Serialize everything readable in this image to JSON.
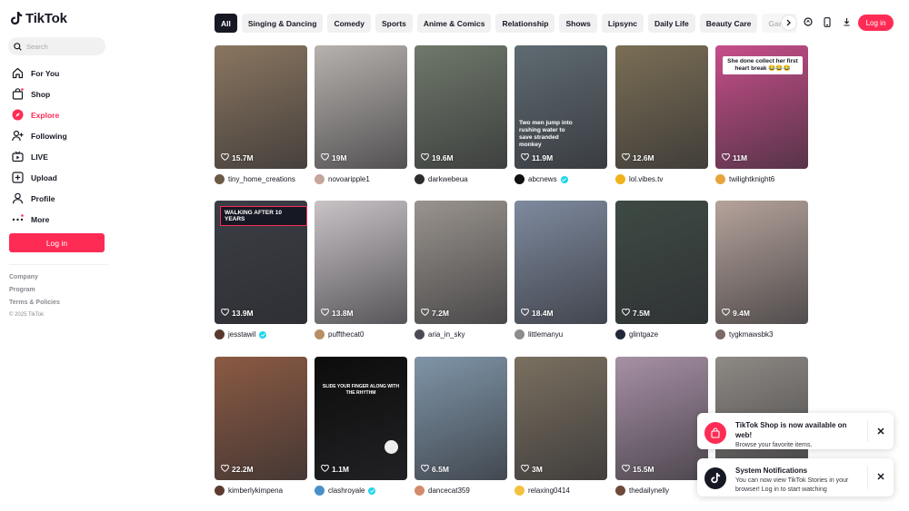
{
  "app": {
    "brand": "TikTok"
  },
  "search": {
    "placeholder": "Search"
  },
  "nav": [
    {
      "label": "For You",
      "icon": "home-icon"
    },
    {
      "label": "Shop",
      "icon": "shop-icon"
    },
    {
      "label": "Explore",
      "icon": "compass-icon",
      "active": true
    },
    {
      "label": "Following",
      "icon": "following-icon"
    },
    {
      "label": "LIVE",
      "icon": "live-icon"
    },
    {
      "label": "Upload",
      "icon": "upload-icon"
    },
    {
      "label": "Profile",
      "icon": "profile-icon"
    },
    {
      "label": "More",
      "icon": "more-icon"
    }
  ],
  "sidebar": {
    "login": "Log in",
    "footer": [
      "Company",
      "Program",
      "Terms & Policies"
    ],
    "copyright": "© 2025 TikTok"
  },
  "header": {
    "login": "Log in"
  },
  "categories": [
    "All",
    "Singing & Dancing",
    "Comedy",
    "Sports",
    "Anime & Comics",
    "Relationship",
    "Shows",
    "Lipsync",
    "Daily Life",
    "Beauty Care",
    "Games"
  ],
  "videos": [
    {
      "views": "15.7M",
      "author": "tiny_home_creations",
      "verified": false,
      "bg": "#8a7660",
      "av": "#6b5a48"
    },
    {
      "views": "19M",
      "author": "novoaripple1",
      "verified": false,
      "bg": "#b7b2ae",
      "av": "#c6a69a"
    },
    {
      "views": "19.6M",
      "author": "darkwebeua",
      "verified": false,
      "bg": "#6f786a",
      "av": "#2d2d2d"
    },
    {
      "views": "11.9M",
      "author": "abcnews",
      "verified": true,
      "bg": "#5f6b72",
      "av": "#111111",
      "overlay": "Two men jump into rushing water to save stranded monkey"
    },
    {
      "views": "12.6M",
      "author": "lol.vibes.tv",
      "verified": false,
      "bg": "#7a6e55",
      "av": "#f2b21b"
    },
    {
      "views": "11M",
      "author": "twilightknight6",
      "verified": false,
      "bg": "#c74e8a",
      "av": "#e7a43b",
      "overlay": "She done collect her first heart break 😂😂😂"
    },
    {
      "views": "13.9M",
      "author": "jesstawil",
      "verified": true,
      "bg": "#3b3e45",
      "av": "#5b3a2e",
      "overlay": "WALKING AFTER 10 YEARS"
    },
    {
      "views": "13.8M",
      "author": "puffthecat0",
      "verified": false,
      "bg": "#c9c3c6",
      "av": "#b88f64"
    },
    {
      "views": "7.2M",
      "author": "aria_in_sky",
      "verified": false,
      "bg": "#9a948e",
      "av": "#4b4b55"
    },
    {
      "views": "18.4M",
      "author": "littlemanyu",
      "verified": false,
      "bg": "#7e8a9e",
      "av": "#8c8c8c"
    },
    {
      "views": "7.5M",
      "author": "glintgaze",
      "verified": false,
      "bg": "#3e4a44",
      "av": "#22283a"
    },
    {
      "views": "9.4M",
      "author": "tygkmawsbk3",
      "verified": false,
      "bg": "#b5a39b",
      "av": "#7a6a66"
    },
    {
      "views": "22.2M",
      "author": "kimberlykimpena",
      "verified": false,
      "bg": "#8b5a43",
      "av": "#5c3a30"
    },
    {
      "views": "1.1M",
      "author": "clashroyale",
      "verified": true,
      "bg": "#0c0c0c",
      "av": "#4a90c8",
      "overlay": "SLIDE YOUR FINGER ALONG WITH THE RHYTHM"
    },
    {
      "views": "6.5M",
      "author": "dancecat359",
      "verified": false,
      "bg": "#7f95a8",
      "av": "#d48b6b"
    },
    {
      "views": "3M",
      "author": "relaxing0414",
      "verified": false,
      "bg": "#7a7060",
      "av": "#f4c13d"
    },
    {
      "views": "15.5M",
      "author": "thedailynelly",
      "verified": false,
      "bg": "#a790a5",
      "av": "#6d4a3a"
    },
    {
      "views": "",
      "author": "",
      "verified": false,
      "bg": "#8e8a85",
      "av": "#ffffff"
    }
  ],
  "toasts": [
    {
      "title": "TikTok Shop is now available on web!",
      "body": "Browse your favorite items.",
      "icon": "shop-bag-icon",
      "color": "#fe2c55"
    },
    {
      "title": "System Notifications",
      "body": "You can now view TikTok Stories in your browser! Log in to start watching",
      "icon": "tiktok-icon",
      "color": "#161823"
    }
  ],
  "colors": {
    "accent": "#fe2c55",
    "verified": "#20d5ec"
  }
}
